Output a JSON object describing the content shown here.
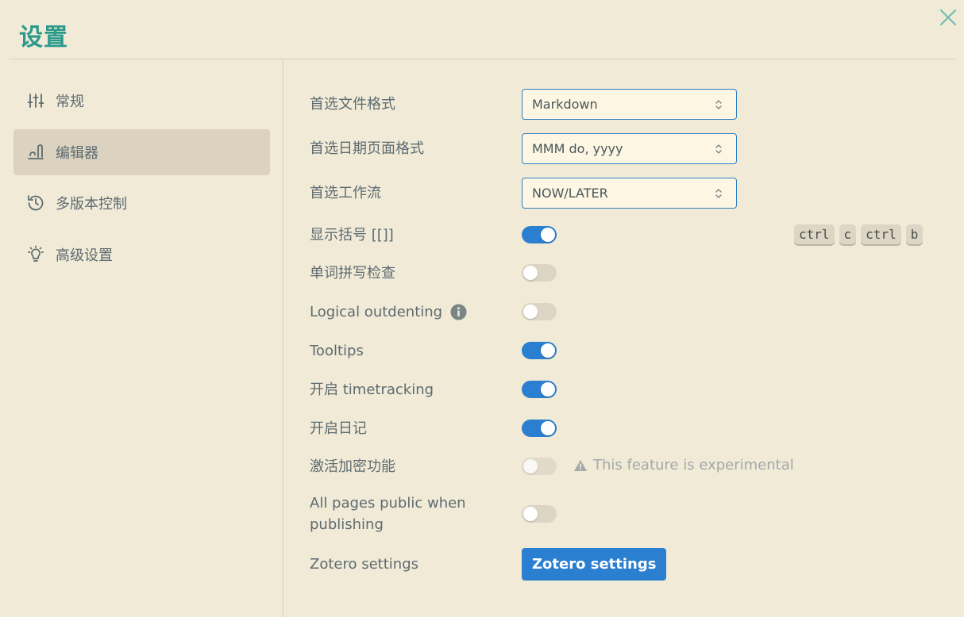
{
  "header": {
    "title": "设置"
  },
  "sidebar": {
    "items": [
      {
        "label": "常规",
        "icon": "sliders-icon"
      },
      {
        "label": "编辑器",
        "icon": "editor-icon",
        "active": true
      },
      {
        "label": "多版本控制",
        "icon": "history-icon"
      },
      {
        "label": "高级设置",
        "icon": "lightbulb-icon"
      }
    ]
  },
  "editor": {
    "file_format": {
      "label": "首选文件格式",
      "value": "Markdown"
    },
    "date_format": {
      "label": "首选日期页面格式",
      "value": "MMM do, yyyy"
    },
    "workflow": {
      "label": "首选工作流",
      "value": "NOW/LATER"
    },
    "brackets": {
      "label": "显示括号 [[]]",
      "on": true,
      "shortcut": [
        "ctrl",
        "c",
        "ctrl",
        "b"
      ]
    },
    "spell_check": {
      "label": "单词拼写检查",
      "on": false
    },
    "logical_outdenting": {
      "label": "Logical outdenting",
      "on": false
    },
    "tooltips": {
      "label": "Tooltips",
      "on": true
    },
    "timetracking": {
      "label": "开启 timetracking",
      "on": true
    },
    "journal": {
      "label": "开启日记",
      "on": true
    },
    "encryption": {
      "label": "激活加密功能",
      "on": false,
      "warning": "This feature is experimental"
    },
    "public_pages": {
      "label_line1": "All pages public when",
      "label_line2": "publishing",
      "on": false
    },
    "zotero": {
      "label": "Zotero settings",
      "button": "Zotero settings"
    }
  },
  "colors": {
    "background": "#f1ead7",
    "accent_title": "#2b9a8c",
    "toggle_on": "#2b7fd0",
    "toggle_off": "#dcd5c4"
  }
}
